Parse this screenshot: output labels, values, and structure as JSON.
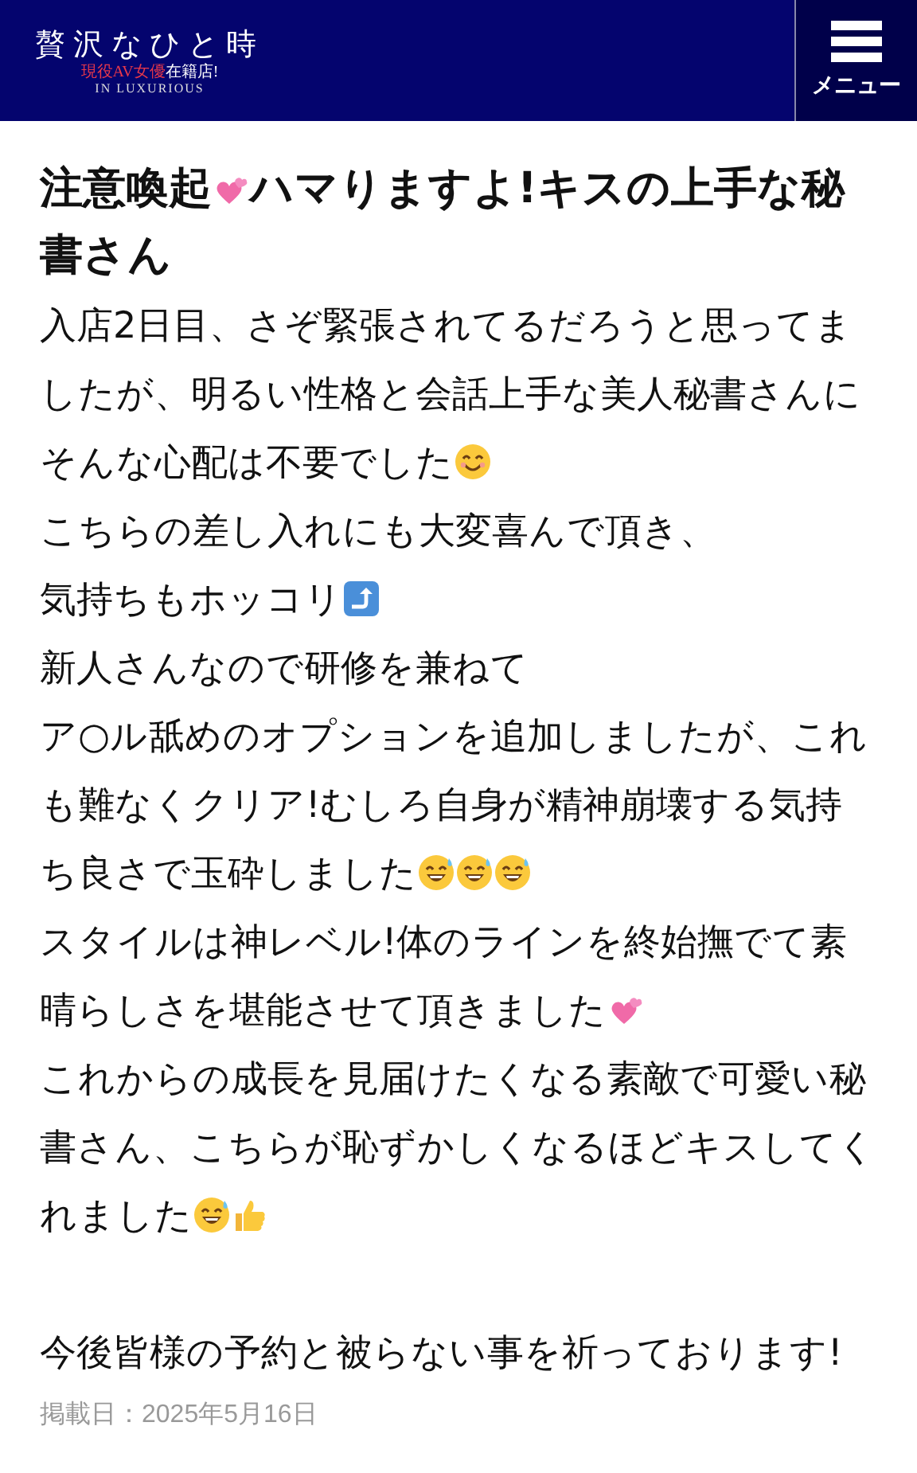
{
  "header": {
    "logo_title": "贅沢なひと時",
    "tagline_highlight": "現役AV女優",
    "tagline_rest": "在籍店!",
    "logo_subtitle": "IN LUXURIOUS",
    "menu_label": "メニュー"
  },
  "article": {
    "title": [
      {
        "kind": "text",
        "text": "注意喚起"
      },
      {
        "kind": "hearts"
      },
      {
        "kind": "text",
        "text": "ハマりますよ!キスの上手な秘書さん"
      }
    ],
    "paragraphs": [
      [
        {
          "kind": "text",
          "text": "入店2日目、さぞ緊張されてるだろうと思ってましたが、明るい性格と会話上手な美人秘書さんにそんな心配は不要でした"
        },
        {
          "kind": "smile"
        }
      ],
      [
        {
          "kind": "text",
          "text": "こちらの差し入れにも大変喜んで頂き、"
        }
      ],
      [
        {
          "kind": "text",
          "text": "気持ちもホッコリ"
        },
        {
          "kind": "arrow"
        }
      ],
      [
        {
          "kind": "text",
          "text": "新人さんなので研修を兼ねて"
        }
      ],
      [
        {
          "kind": "text",
          "text": "ア○ル舐めのオプションを追加しましたが、これも難なくクリア!むしろ自身が精神崩壊する気持ち良さで玉砕しました"
        },
        {
          "kind": "sweat"
        },
        {
          "kind": "sweat"
        },
        {
          "kind": "sweat"
        }
      ],
      [
        {
          "kind": "text",
          "text": "スタイルは神レベル!体のラインを終始撫でて素晴らしさを堪能させて頂きました"
        },
        {
          "kind": "hearts"
        }
      ],
      [
        {
          "kind": "text",
          "text": "これからの成長を見届けたくなる素敵で可愛い秘書さん、こちらが恥ずかしくなるほどキスしてくれました"
        },
        {
          "kind": "sweat"
        },
        {
          "kind": "thumbsup"
        }
      ]
    ],
    "closing": "今後皆様の予約と被らない事を祈っております!",
    "date": "掲載日：2025年5月16日"
  }
}
